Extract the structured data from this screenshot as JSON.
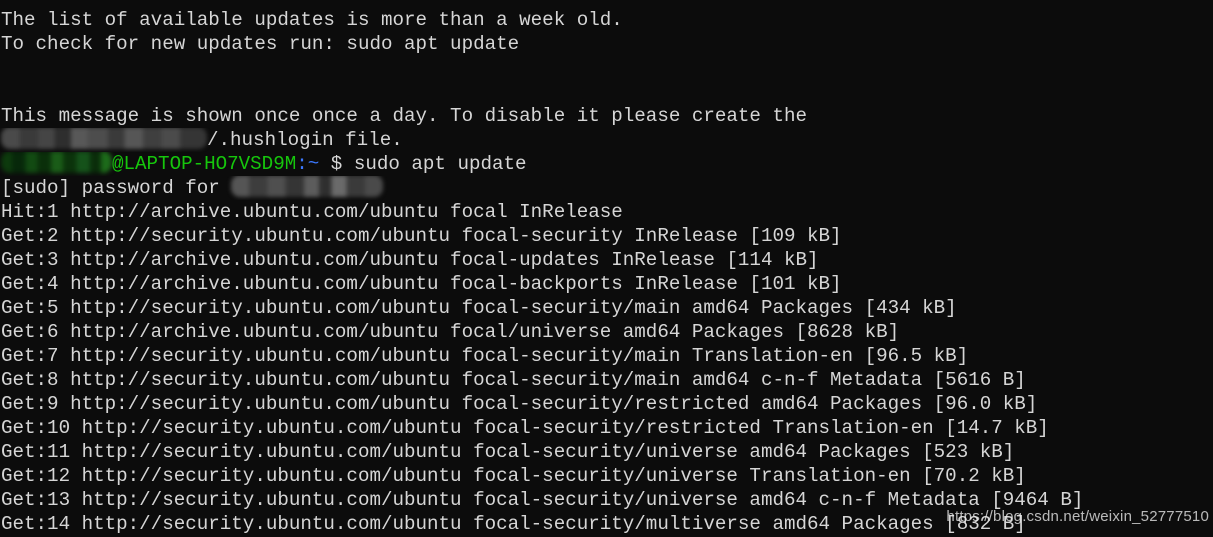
{
  "terminal": {
    "background_color": "#0c0c0c",
    "foreground_color": "#d6d6d6",
    "prompt_color": "#16c60c",
    "path_color": "#3b78ff",
    "motd": {
      "line1": "The list of available updates is more than a week old.",
      "line2": "To check for new updates run: sudo apt update",
      "line3": "This message is shown once once a day. To disable it please create the",
      "hushlogin_suffix": "/.hushlogin file."
    },
    "prompt": {
      "user_redacted": true,
      "host": "@LAPTOP-HO7VSD9M",
      "colon": ":",
      "cwd": "~",
      "sigil": "$",
      "command": "sudo apt update"
    },
    "sudo_prompt": {
      "prefix": "[sudo] password for ",
      "user_redacted": true
    },
    "apt_lines": [
      "Hit:1 http://archive.ubuntu.com/ubuntu focal InRelease",
      "Get:2 http://security.ubuntu.com/ubuntu focal-security InRelease [109 kB]",
      "Get:3 http://archive.ubuntu.com/ubuntu focal-updates InRelease [114 kB]",
      "Get:4 http://archive.ubuntu.com/ubuntu focal-backports InRelease [101 kB]",
      "Get:5 http://security.ubuntu.com/ubuntu focal-security/main amd64 Packages [434 kB]",
      "Get:6 http://archive.ubuntu.com/ubuntu focal/universe amd64 Packages [8628 kB]",
      "Get:7 http://security.ubuntu.com/ubuntu focal-security/main Translation-en [96.5 kB]",
      "Get:8 http://security.ubuntu.com/ubuntu focal-security/main amd64 c-n-f Metadata [5616 B]",
      "Get:9 http://security.ubuntu.com/ubuntu focal-security/restricted amd64 Packages [96.0 kB]",
      "Get:10 http://security.ubuntu.com/ubuntu focal-security/restricted Translation-en [14.7 kB]",
      "Get:11 http://security.ubuntu.com/ubuntu focal-security/universe amd64 Packages [523 kB]",
      "Get:12 http://security.ubuntu.com/ubuntu focal-security/universe Translation-en [70.2 kB]",
      "Get:13 http://security.ubuntu.com/ubuntu focal-security/universe amd64 c-n-f Metadata [9464 B]",
      "Get:14 http://security.ubuntu.com/ubuntu focal-security/multiverse amd64 Packages [832 B]"
    ]
  },
  "watermark": {
    "text": "https://blog.csdn.net/weixin_52777510"
  }
}
